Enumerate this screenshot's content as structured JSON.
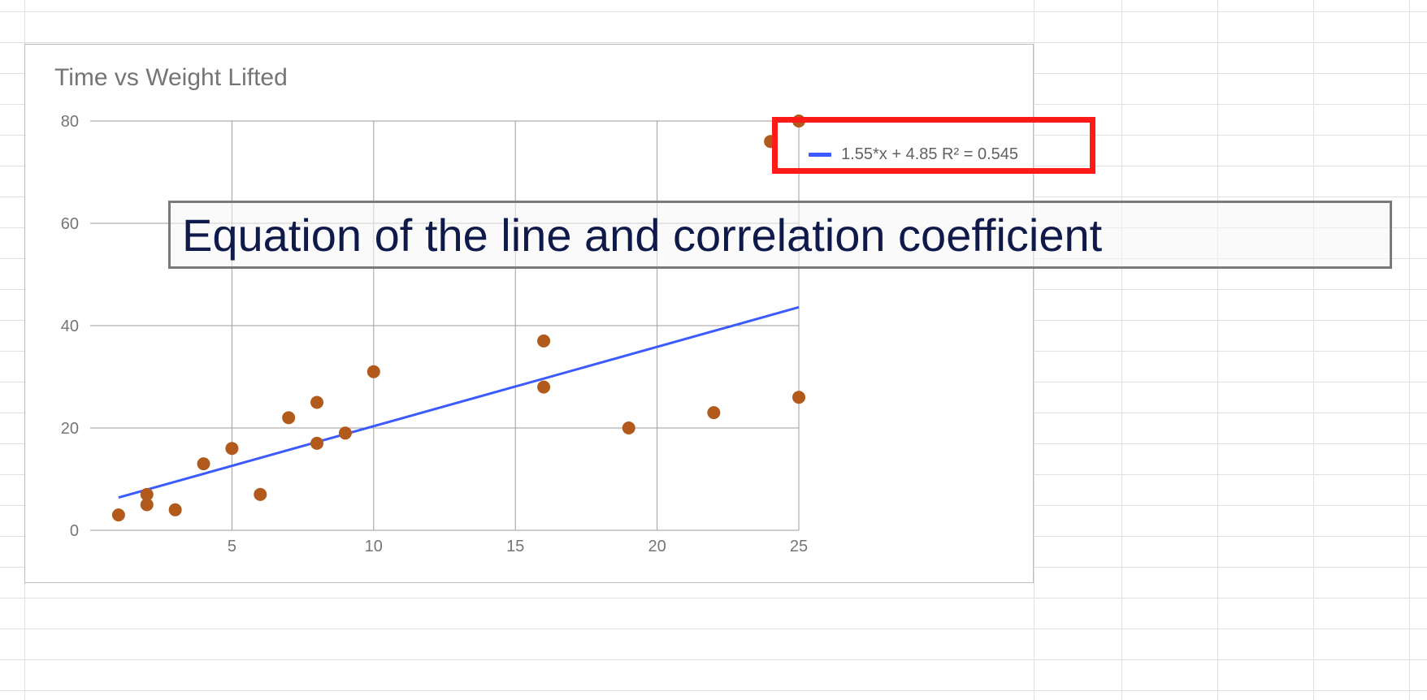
{
  "chart_data": {
    "type": "scatter",
    "title": "Time vs Weight Lifted",
    "xlabel": "",
    "ylabel": "",
    "x_ticks": [
      5,
      10,
      15,
      20,
      25
    ],
    "y_ticks": [
      0,
      20,
      40,
      60,
      80
    ],
    "xlim": [
      0,
      25
    ],
    "ylim": [
      0,
      80
    ],
    "points": [
      {
        "x": 1,
        "y": 3
      },
      {
        "x": 2,
        "y": 5
      },
      {
        "x": 2,
        "y": 7
      },
      {
        "x": 3,
        "y": 4
      },
      {
        "x": 4,
        "y": 13
      },
      {
        "x": 5,
        "y": 16
      },
      {
        "x": 6,
        "y": 7
      },
      {
        "x": 7,
        "y": 22
      },
      {
        "x": 8,
        "y": 25
      },
      {
        "x": 8,
        "y": 17
      },
      {
        "x": 9,
        "y": 19
      },
      {
        "x": 10,
        "y": 31
      },
      {
        "x": 16,
        "y": 37
      },
      {
        "x": 16,
        "y": 28
      },
      {
        "x": 19,
        "y": 20
      },
      {
        "x": 22,
        "y": 23
      },
      {
        "x": 24,
        "y": 76
      },
      {
        "x": 25,
        "y": 80
      },
      {
        "x": 25,
        "y": 26
      }
    ],
    "trendline": {
      "equation": "1.55*x + 4.85",
      "r_squared": 0.545,
      "slope": 1.55,
      "intercept": 4.85,
      "x_draw_min": 1,
      "x_draw_max": 25
    },
    "legend": {
      "text": "1.55*x + 4.85 R² = 0.545",
      "position": "right"
    }
  },
  "annotation": {
    "text": "Equation of the line and correlation coefficient"
  }
}
